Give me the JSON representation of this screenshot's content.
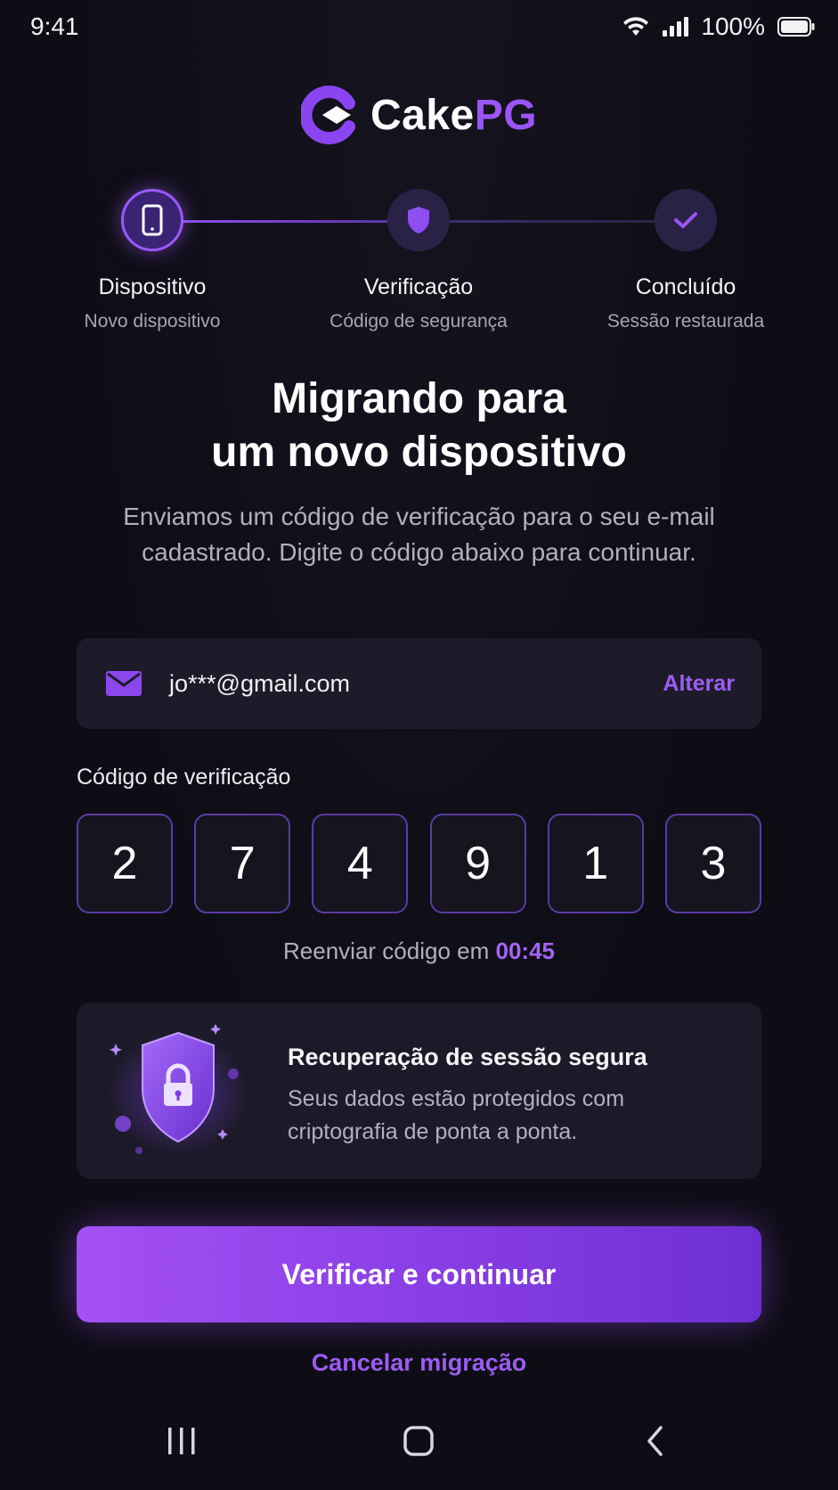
{
  "status_bar": {
    "time": "9:41",
    "battery": "100%",
    "icons": [
      "wifi-icon",
      "signal-icon",
      "battery-icon"
    ]
  },
  "brand": {
    "name_part1": "Cake",
    "name_part2": "PG",
    "accent_color": "#9a55f5"
  },
  "stepper": {
    "steps": [
      {
        "title": "Dispositivo",
        "subtitle": "Novo dispositivo",
        "icon": "phone-icon",
        "state": "active"
      },
      {
        "title": "Verificação",
        "subtitle": "Código de segurança",
        "icon": "shield-icon",
        "state": "pending"
      },
      {
        "title": "Concluído",
        "subtitle": "Sessão restaurada",
        "icon": "check-icon",
        "state": "pending"
      }
    ]
  },
  "heading": {
    "line1": "Migrando para",
    "line2": "um novo dispositivo"
  },
  "subtitle": "Enviamos um código de verificação para o seu e-mail cadastrado. Digite o código abaixo para continuar.",
  "email_card": {
    "email": "jo***@gmail.com",
    "change_label": "Alterar",
    "icon": "mail-icon"
  },
  "code": {
    "label": "Código de verificação",
    "digits": [
      "2",
      "7",
      "4",
      "9",
      "1",
      "3"
    ]
  },
  "resend": {
    "text": "Reenviar código em ",
    "timer": "00:45"
  },
  "security_card": {
    "title": "Recuperação de sessão segura",
    "text": "Seus dados estão protegidos com criptografia de ponta a ponta.",
    "icon": "shield-lock-icon"
  },
  "actions": {
    "verify_label": "Verificar e continuar",
    "cancel_label": "Cancelar migração"
  },
  "nav_bar": {
    "buttons": [
      "recent-apps-icon",
      "home-icon",
      "back-icon"
    ]
  }
}
